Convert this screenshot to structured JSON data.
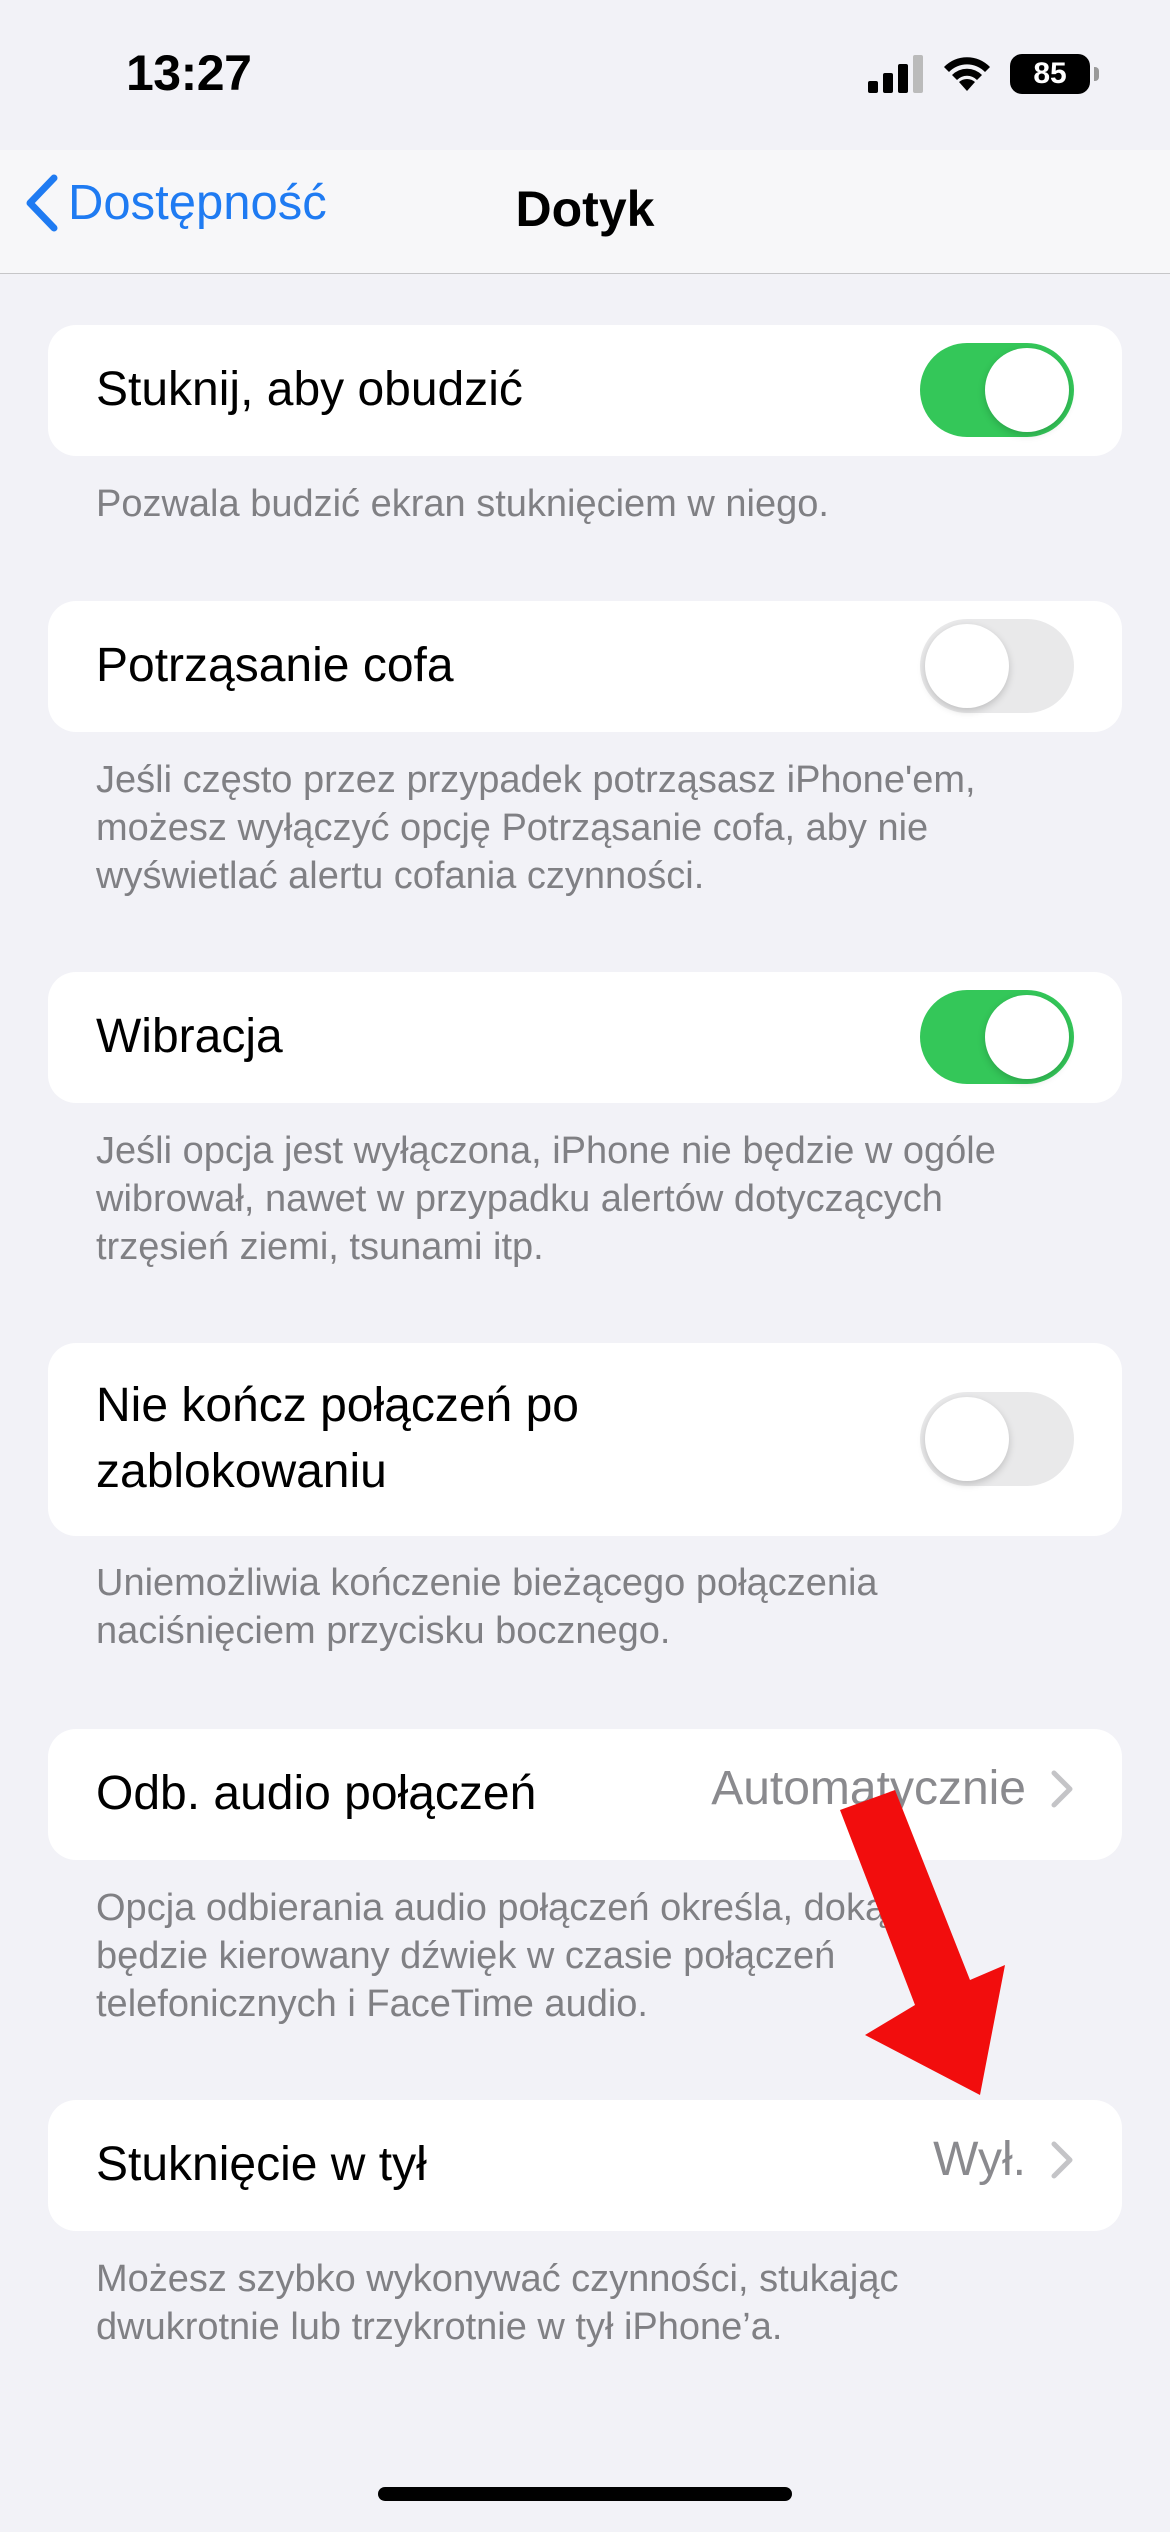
{
  "status_bar": {
    "time": "13:27",
    "battery": "85"
  },
  "nav": {
    "back_label": "Dostępność",
    "title": "Dotyk"
  },
  "settings": [
    {
      "label": "Stuknij, aby obudzić",
      "toggle": "on",
      "footer": [
        "Pozwala budzić ekran stuknięciem w niego."
      ]
    },
    {
      "label": "Potrząsanie cofa",
      "toggle": "off",
      "footer": [
        "Jeśli często przez przypadek potrząsasz iPhone'em,",
        "możesz wyłączyć opcję Potrząsanie cofa, aby nie",
        "wyświetlać alertu cofania czynności."
      ]
    },
    {
      "label": "Wibracja",
      "toggle": "on",
      "footer": [
        "Jeśli opcja jest wyłączona, iPhone nie będzie w ogóle",
        "wibrował, nawet w przypadku alertów dotyczących",
        "trzęsień ziemi, tsunami itp."
      ]
    },
    {
      "label_lines": [
        "Nie kończ połączeń po",
        "zablokowaniu"
      ],
      "toggle": "off",
      "footer": [
        "Uniemożliwia kończenie bieżącego połączenia",
        "naciśnięciem przycisku bocznego."
      ]
    },
    {
      "label": "Odb. audio połączeń",
      "value": "Automatycznie",
      "footer": [
        "Opcja odbierania audio połączeń określa, dokąd",
        "będzie kierowany dźwięk w czasie połączeń",
        "telefonicznych i FaceTime audio."
      ]
    },
    {
      "label": "Stuknięcie w tył",
      "value": "Wył.",
      "footer": [
        "Możesz szybko wykonywać czynności, stukając",
        "dwukrotnie lub trzykrotnie w tył iPhone’a."
      ]
    }
  ],
  "colors": {
    "accent": "#1f7bf2",
    "toggle_on": "#34c759",
    "annotation_arrow": "#f20d0d"
  }
}
